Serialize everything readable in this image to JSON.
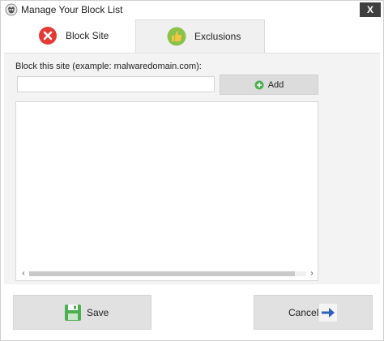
{
  "window": {
    "title": "Manage Your Block List",
    "close_glyph": "X",
    "app_icon": "shield-icon"
  },
  "tabs": [
    {
      "label": "Block Site",
      "icon": "block-x-icon",
      "selected": true,
      "icon_color": "#e53935"
    },
    {
      "label": "Exclusions",
      "icon": "thumbs-up-icon",
      "selected": false,
      "icon_color": "#8bc34a"
    }
  ],
  "block": {
    "field_label": "Block this site (example: malwaredomain.com):",
    "input_value": "",
    "add_label": "Add",
    "add_icon_color": "#4caf50",
    "sites": []
  },
  "footer": {
    "save_label": "Save",
    "save_icon_color": "#4caf50",
    "cancel_label": "Cancel",
    "cancel_icon_color": "#2f5fbf"
  },
  "scrollbar": {
    "left_glyph": "‹",
    "right_glyph": "›"
  }
}
